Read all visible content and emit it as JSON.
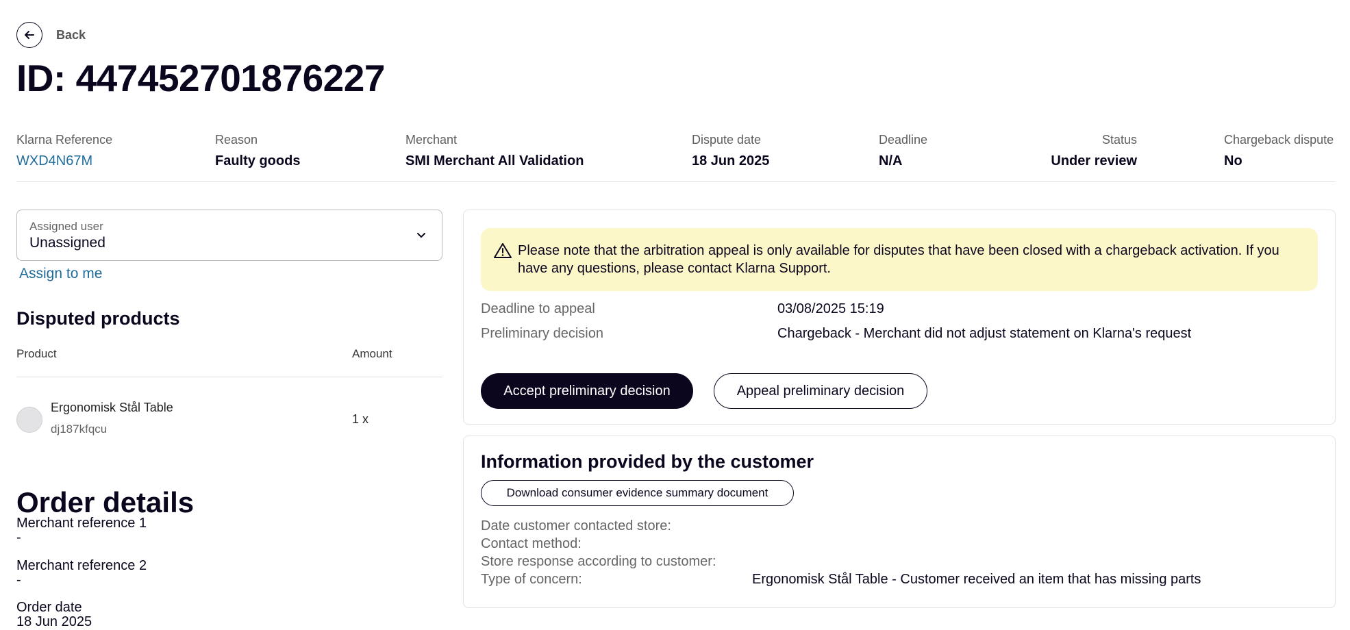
{
  "nav": {
    "back_label": "Back"
  },
  "page_title": "ID: 447452701876227",
  "summary": {
    "klarna_reference": {
      "label": "Klarna Reference",
      "value": "WXD4N67M"
    },
    "reason": {
      "label": "Reason",
      "value": "Faulty goods"
    },
    "merchant": {
      "label": "Merchant",
      "value": "SMI Merchant All Validation"
    },
    "dispute_date": {
      "label": "Dispute date",
      "value": "18 Jun 2025"
    },
    "deadline": {
      "label": "Deadline",
      "value": "N/A"
    },
    "status": {
      "label": "Status",
      "value": "Under review"
    },
    "chargeback_dispute": {
      "label": "Chargeback dispute",
      "value": "No"
    }
  },
  "assign": {
    "label": "Assigned user",
    "value": "Unassigned",
    "assign_to_me": "Assign to me"
  },
  "disputed_products": {
    "title": "Disputed products",
    "columns": [
      "Product",
      "Amount"
    ],
    "rows": [
      {
        "name": "Ergonomisk Stål Table",
        "sku": "dj187kfqcu",
        "amount": "1 x"
      }
    ]
  },
  "order_details": {
    "title": "Order details",
    "fields": [
      {
        "label": "Merchant reference 1",
        "value": "-"
      },
      {
        "label": "Merchant reference 2",
        "value": "-"
      },
      {
        "label": "Order date",
        "value": "18 Jun 2025"
      }
    ]
  },
  "decision_card": {
    "notice": "Please note that the arbitration appeal is only available for disputes that have been closed with a chargeback activation. If you have any questions, please contact Klarna Support.",
    "deadline_label": "Deadline to appeal",
    "deadline_value": "03/08/2025 15:19",
    "preliminary_label": "Preliminary decision",
    "preliminary_value": "Chargeback - Merchant did not adjust statement on Klarna's request",
    "accept_label": "Accept preliminary decision",
    "appeal_label": "Appeal preliminary decision"
  },
  "customer_info": {
    "title": "Information provided by the customer",
    "download_label": "Download consumer evidence summary document",
    "fields": [
      {
        "label": "Date customer contacted store:",
        "value": ""
      },
      {
        "label": "Contact method:",
        "value": ""
      },
      {
        "label": "Store response according to customer:",
        "value": ""
      },
      {
        "label": "Type of concern:",
        "value": "Ergonomisk Stål Table - Customer received an item that has missing parts"
      }
    ]
  },
  "colors": {
    "text": "#0b051d",
    "link": "#1f6b9a",
    "notice_bg": "#fcf7c8",
    "primary_button": "#0b051d"
  },
  "icons": {
    "back": "arrow-left-icon",
    "dropdown": "chevron-down-icon",
    "warning": "warning-triangle-icon",
    "product": "product-avatar"
  }
}
